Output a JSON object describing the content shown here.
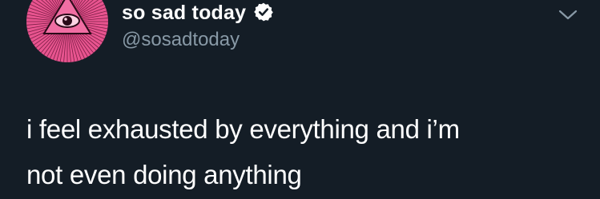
{
  "author": {
    "display_name": "so sad today",
    "handle": "@sosadtoday",
    "verified": true,
    "avatar_icon": "eye-triangle-sunburst-icon"
  },
  "menu": {
    "icon": "chevron-down-icon"
  },
  "tweet": {
    "lines": [
      "i feel exhausted by everything and i’m",
      "not even doing anything"
    ]
  },
  "colors": {
    "background": "#141d26",
    "text": "#ffffff",
    "secondary_text": "#8899a6",
    "avatar_pink": "#e8548f",
    "verified_badge": "#ffffff"
  }
}
